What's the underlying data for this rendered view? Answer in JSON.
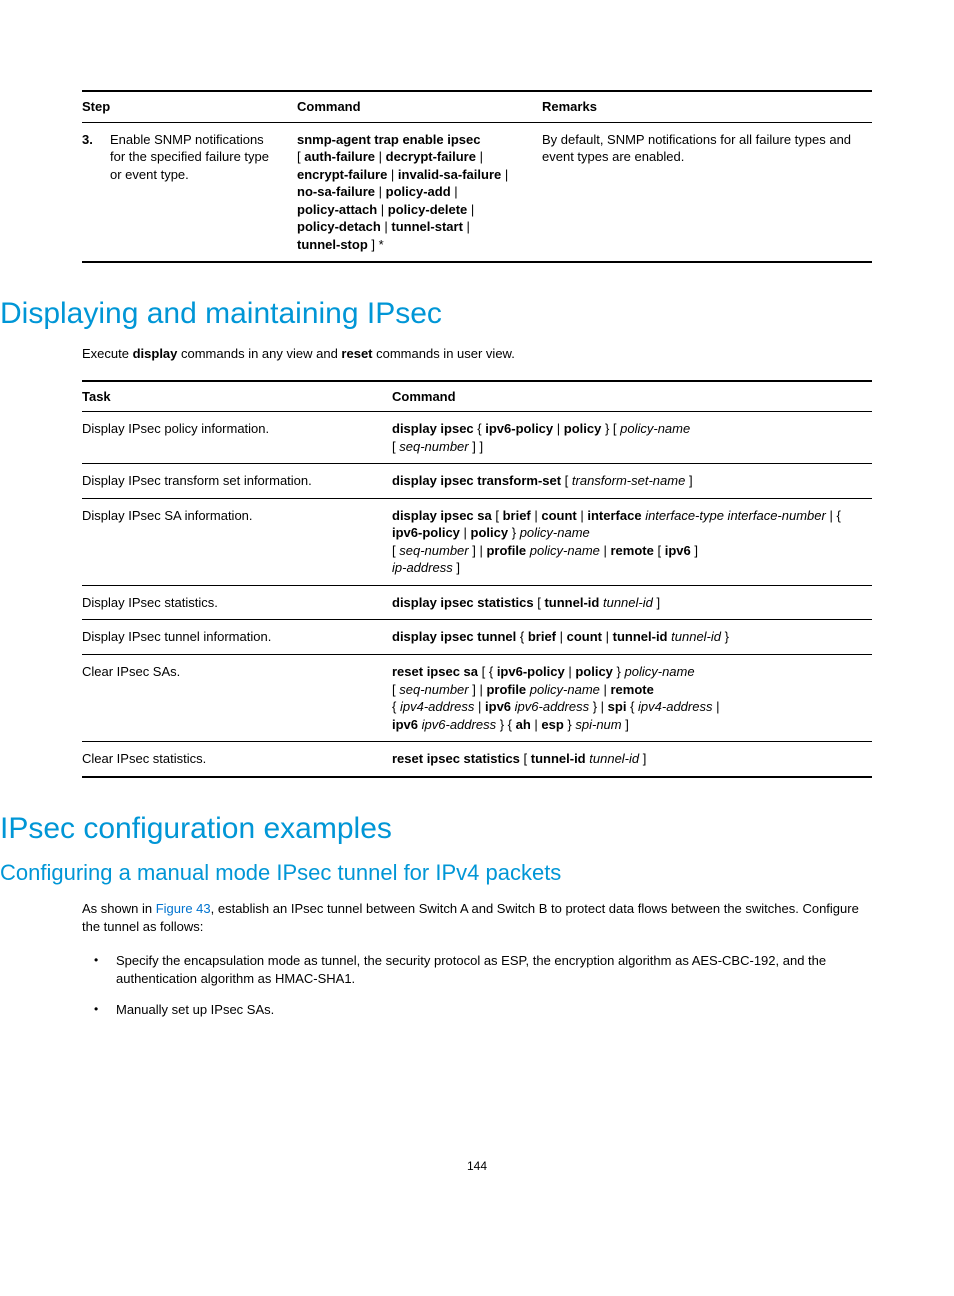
{
  "table1": {
    "headers": {
      "step": "Step",
      "command": "Command",
      "remarks": "Remarks"
    },
    "row": {
      "num": "3.",
      "text": "Enable SNMP notifications for the specified failure type or event type.",
      "remarks": "By default, SNMP notifications for all failure types and event types are enabled."
    }
  },
  "sec1": {
    "title": "Displaying and maintaining IPsec",
    "intro_pre": "Execute ",
    "intro_b1": "display",
    "intro_mid": " commands in any view and ",
    "intro_b2": "reset",
    "intro_post": " commands in user view."
  },
  "table2": {
    "headers": {
      "task": "Task",
      "command": "Command"
    },
    "rows": {
      "r0": {
        "task": "Display IPsec policy information."
      },
      "r1": {
        "task": "Display IPsec transform set information."
      },
      "r2": {
        "task": "Display IPsec SA information."
      },
      "r3": {
        "task": "Display IPsec statistics."
      },
      "r4": {
        "task": "Display IPsec tunnel information."
      },
      "r5": {
        "task": "Clear IPsec SAs."
      },
      "r6": {
        "task": "Clear IPsec statistics."
      }
    }
  },
  "sec2": {
    "title": "IPsec configuration examples",
    "subtitle": "Configuring a manual mode IPsec tunnel for IPv4 packets",
    "p1_pre": "As shown in ",
    "p1_link": "Figure 43",
    "p1_post": ", establish an IPsec tunnel between Switch A and Switch B to protect data flows between the switches. Configure the tunnel as follows:",
    "bullet1": "Specify the encapsulation mode as tunnel, the security protocol as ESP, the encryption algorithm as AES-CBC-192, and the authentication algorithm as HMAC-SHA1.",
    "bullet2": "Manually set up IPsec SAs."
  },
  "pagenum": "144",
  "cmd": {
    "t1": {
      "a": "snmp-agent trap enable ipsec",
      "b": "auth-failure",
      "c": "decrypt-failure",
      "d": "encrypt-failure",
      "e": "invalid-sa-failure",
      "f": "no-sa-failure",
      "g": "policy-add",
      "h": "policy-attach",
      "i": "policy-delete",
      "j": "policy-detach",
      "k": "tunnel-start",
      "l": "tunnel-stop"
    },
    "r0": {
      "a": "display ipsec",
      "b": "ipv6-policy",
      "c": "policy",
      "d": "policy-name",
      "e": "seq-number"
    },
    "r1": {
      "a": "display ipsec transform-set",
      "b": "transform-set-name"
    },
    "r2": {
      "a": "display ipsec sa",
      "b": "brief",
      "c": "count",
      "d": "interface",
      "e": "interface-type interface-number",
      "f": "ipv6-policy",
      "g": "policy",
      "h": "policy-name",
      "i": "seq-number",
      "j": "profile",
      "k": "policy-name",
      "l": "remote",
      "m": "ipv6",
      "n": "ip-address"
    },
    "r3": {
      "a": "display ipsec statistics",
      "b": "tunnel-id",
      "c": "tunnel-id"
    },
    "r4": {
      "a": "display ipsec tunnel",
      "b": "brief",
      "c": "count",
      "d": "tunnel-id",
      "e": "tunnel-id"
    },
    "r5": {
      "a": "reset ipsec sa",
      "b": "ipv6-policy",
      "c": "policy",
      "d": "policy-name",
      "e": "seq-number",
      "f": "profile",
      "g": "policy-name",
      "h": "remote",
      "i": "ipv4-address",
      "j": "ipv6",
      "k": "ipv6-address",
      "l": "spi",
      "m": "ipv4-address",
      "n": "ipv6",
      "o": "ipv6-address",
      "p": "ah",
      "q": "esp",
      "r": "spi-num"
    },
    "r6": {
      "a": "reset ipsec statistics",
      "b": "tunnel-id",
      "c": "tunnel-id"
    }
  }
}
